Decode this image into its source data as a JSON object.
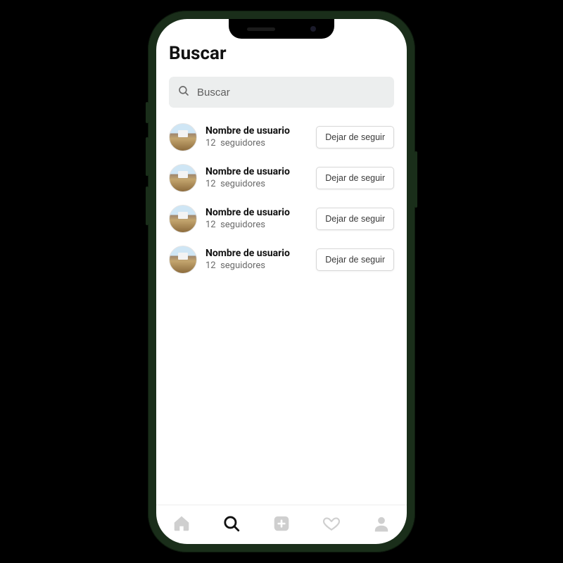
{
  "page": {
    "title": "Buscar"
  },
  "search": {
    "placeholder": "Buscar",
    "value": ""
  },
  "users": [
    {
      "name": "Nombre de usuario",
      "followers_count": "12",
      "followers_label": "seguidores",
      "action_label": "Dejar de seguir"
    },
    {
      "name": "Nombre de usuario",
      "followers_count": "12",
      "followers_label": "seguidores",
      "action_label": "Dejar de seguir"
    },
    {
      "name": "Nombre de usuario",
      "followers_count": "12",
      "followers_label": "seguidores",
      "action_label": "Dejar de seguir"
    },
    {
      "name": "Nombre de usuario",
      "followers_count": "12",
      "followers_label": "seguidores",
      "action_label": "Dejar de seguir"
    }
  ],
  "nav": {
    "items": [
      {
        "name": "home",
        "active": false
      },
      {
        "name": "search",
        "active": true
      },
      {
        "name": "add",
        "active": false
      },
      {
        "name": "likes",
        "active": false
      },
      {
        "name": "profile",
        "active": false
      }
    ]
  }
}
